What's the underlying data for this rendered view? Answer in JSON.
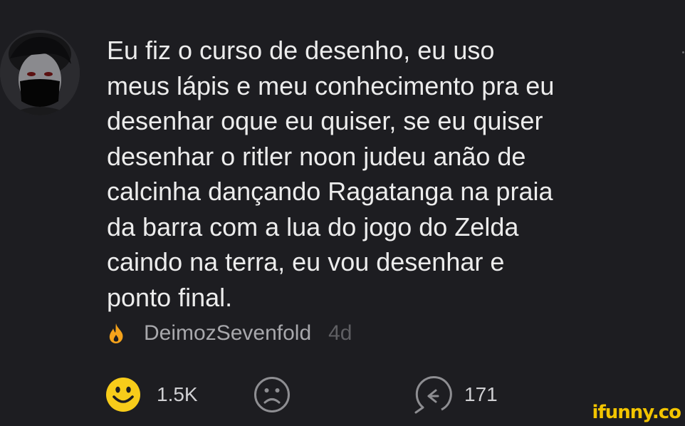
{
  "post": {
    "text": "Eu fiz o curso de desenho, eu uso meus lápis e meu conhecimento pra eu desenhar oque eu quiser, se eu quiser desenhar o ritler noon judeu anão de calcinha dançando Ragatanga na praia da barra com a lua do jogo do Zelda caindo na terra, eu vou desenhar e ponto final.",
    "lines": [
      "Eu fiz o curso de desenho, eu uso",
      "meus lápis e meu conhecimento pra eu",
      "desenhar oque eu quiser, se eu quiser",
      "desenhar o ritler noon judeu anão de",
      "calcinha dançando Ragatanga na praia",
      "da barra com a lua do jogo do Zelda",
      "caindo na terra, eu vou desenhar e",
      "ponto final."
    ]
  },
  "author": {
    "name": "DeimozSevenfold",
    "time": "4d",
    "icon": "flame-icon"
  },
  "actions": {
    "smile": {
      "count": "1.5K",
      "icon": "smile-emoji-icon"
    },
    "frown": {
      "icon": "frown-icon"
    },
    "republish": {
      "count": "171",
      "icon": "republish-icon"
    }
  },
  "watermark": "ifunny.co",
  "colors": {
    "background": "#1d1d21",
    "text": "#ececec",
    "author": "#a8a8ac",
    "time": "#5f5f63",
    "accent_yellow": "#f7cc1a",
    "flame_orange": "#f4a21b"
  }
}
